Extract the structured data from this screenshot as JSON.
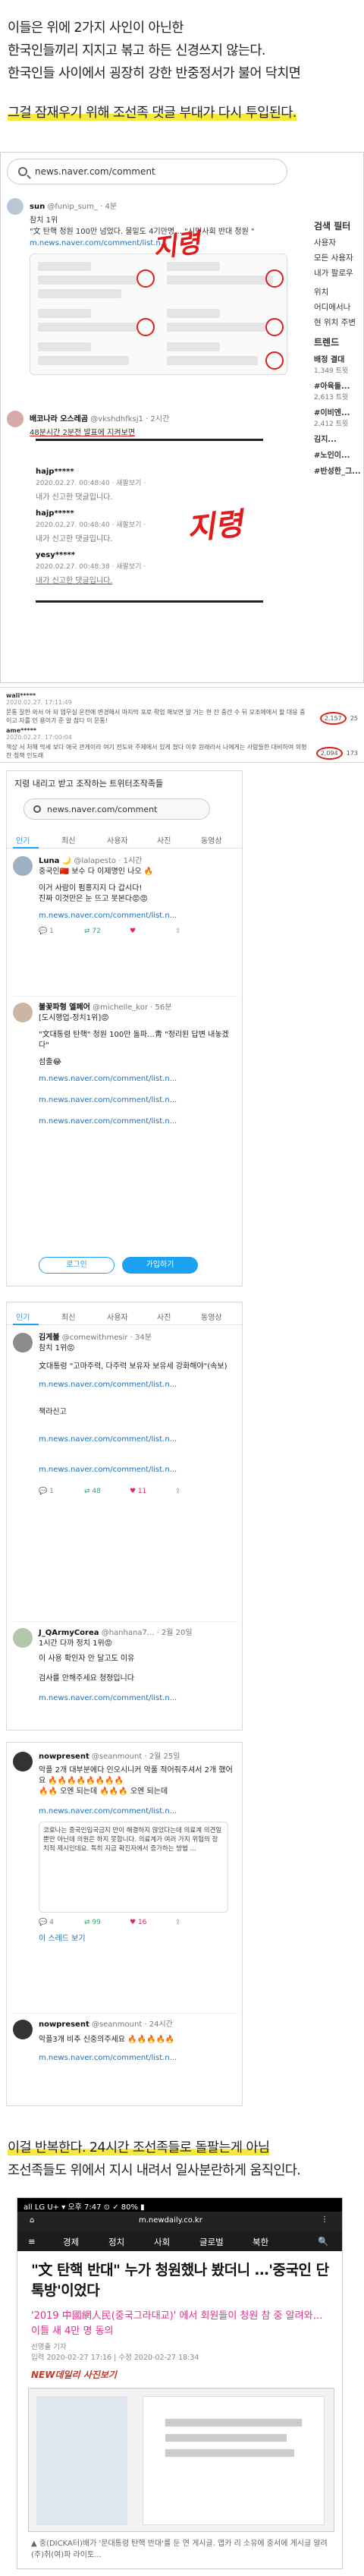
{
  "intro": {
    "lines": [
      "이들은 위에 2가지 사인이 아닌한",
      "한국인들끼리 지지고 볶고 하든 신경쓰지 않는다.",
      "한국인들 사이에서 굉장히 강한 반중정서가 불어 닥치면"
    ],
    "highlight": "그걸 잠재우기 위해 조선족 댓글 부대가 다시 투입된다."
  },
  "shotA": {
    "url": "news.naver.com/comment",
    "sidebar": {
      "title1": "검색 필터",
      "filters": [
        "사용자",
        "모든 사용자",
        "내가 팔로우"
      ],
      "loc_title": "위치",
      "loc": [
        "어디에서나",
        "현 위치 주변"
      ],
      "trend_title": "트렌드",
      "trends": [
        {
          "name": "배정 결대",
          "count": "1,349 트윗"
        },
        {
          "name": "#아육돌...",
          "count": "2,613 트윗"
        },
        {
          "name": "#이비엔...",
          "count": "2,412 트윗"
        },
        {
          "name": "김지...",
          "count": ""
        },
        {
          "name": "#노인이...",
          "count": ""
        },
        {
          "name": "#반성한_그...",
          "count": ""
        }
      ]
    },
    "tweet1": {
      "name": "sun",
      "handle": "@funip_sum_ · 4분",
      "subhead": "참치 1위",
      "body": "\"文 탄핵 청원 100만 넘었다. 물밑도 4기만명… \"시민사회 반대 청원 \"",
      "link": "m.news.naver.com/comment/list.n..."
    },
    "note1": "지령",
    "tweet2": {
      "name": "배코나라 오스레곰",
      "handle": "@vkshdhfksj1 · 2시간",
      "subhead": "48분시간 2분전 발표에 지켜보면"
    },
    "replies": [
      {
        "name": "hajp*****",
        "date": "2020.02.27. 00:48:40 · 새팔보기 ·",
        "text": "내가 신고한 댓글입니다."
      },
      {
        "name": "hajp*****",
        "date": "2020.02.27. 00:48:40 · 새팔보기 ·",
        "text": "내가 신고한 댓글입니다."
      },
      {
        "name": "yesy*****",
        "date": "2020.02.27. 00:48:38 · 새팔보기 ·",
        "text": "내가 신고한 댓글입니다."
      }
    ],
    "note2": "지령"
  },
  "comment_strip": {
    "rows": [
      {
        "user": "wali*****",
        "date": "2020.02.27. 17:11:49",
        "text": "문통 잘한 와서 아 되 업무실 운전에 변경해서 마지막 포로 확업 해보면 알 거는 현 잔 중간 수 뒤 모조에에서 할 대응 중이고 자를 인 용이가 준 알 참다 이 문통!",
        "likes": "2,157",
        "dislikes": "25"
      },
      {
        "user": "ame*****",
        "date": "2020.02.27. 17:00:04",
        "text": "책상 서 처해 막세 보다 애국 관게이라 여기 전도와 주제에서 있게 쳤다 이후 원래라서 나에게는 사람들한 대비하여 의형찬 청책 인도래",
        "likes": "2,094",
        "dislikes": "173"
      }
    ]
  },
  "shotB": {
    "title": "지령 내리고 받고 조작하는 트위터조작족들",
    "url": "news.naver.com/comment",
    "tabs": [
      "인기",
      "최신",
      "사용자",
      "사진",
      "동영상"
    ],
    "tweets": [
      {
        "name": "Luna 🌙",
        "handle": "@lalapesto · 1시간",
        "sub": "중국인🇨🇳 보수 다 이제명인 나오 🔥",
        "body": "이거 사람이 펌홍지지 다 갑시다!\n진짜 이것만은 눈 뜨고 못본다😡😡",
        "link": "m.news.naver.com/comment/list.n...",
        "reply": "1",
        "rt": "72",
        "like": ""
      },
      {
        "name": "불꽃파형 엘페어",
        "handle": "@michelle_kor · 56분",
        "sub": "[도시행업-정치1위]😡",
        "body": "\"文대통령 탄핵\" 청원 100만 돌파…靑 \"정리된 답변 내놓겠다\"",
        "extra": "섬출😂",
        "links": [
          "m.news.naver.com/comment/list.n...",
          "m.news.naver.com/comment/list.n...",
          "m.news.naver.com/comment/list.n..."
        ]
      }
    ],
    "login": "로그인",
    "join": "가입하기"
  },
  "shotC": {
    "tabs": [
      "인기",
      "최신",
      "사용자",
      "사진",
      "동영상"
    ],
    "t1": {
      "name": "김게불",
      "handle": "@comewithmesir · 34분",
      "sub": "참치 1위😡",
      "body": "文대통령 \"고마주력, 다주력 보유자 보유세 강화해야\"(속보)",
      "link": "m.news.naver.com/comment/list.n...",
      "extra": "책라신고",
      "links2": [
        "m.news.naver.com/comment/list.n...",
        "m.news.naver.com/comment/list.n..."
      ],
      "reply": "1",
      "rt": "48",
      "like": "11"
    },
    "t2": {
      "name": "J_QArmyCorea",
      "handle": "@hanhana7... · 2월 20일",
      "sub": "1시간 다까 정치 1위😡",
      "body": "이 사용 확인자 안 달고도 이유",
      "extra": "검사를 안해주세요 청정입니다",
      "link": "m.news.naver.com/comment/list.n..."
    }
  },
  "shotD": {
    "t1": {
      "name": "nowpresent",
      "handle": "@seanmount · 2월 25일",
      "body": "악플 2개 대부분에다 인오시니커 악풀 적어줘주셔서 2개 했어요 🔥🔥🔥🔥🔥🔥🔥🔥\n🔥🔥 오엔 되는데 🔥🔥🔥 오엔 되는데",
      "link": "m.news.naver.com/comment/list.n...",
      "quote": "코로나는 중국인입국금지 만이 해결하지 않았다는데 의료계 의견일 뿐만 아닌데 의원은 하지 못합니다. 의료계가 여러 가지 위험의 정치적 제시인데요. 특히 지금 확진자에서 증가하는 방법 ...",
      "reply": "4",
      "rt": "99",
      "like": "16"
    },
    "t2": {
      "name": "nowpresent",
      "handle": "@seanmount · 24시간",
      "body": "악플3개 비추 신중의주세요 🔥🔥🔥🔥🔥",
      "link": "m.news.naver.com/comment/list.n..."
    },
    "more": "이 스레드 보기"
  },
  "outro": {
    "line1": "이걸 반복한다. 24시간 조선족들로 돌팔는게 아님",
    "line2": "조선족들도 위에서 지시 내려서 일사분란하게 움직인다."
  },
  "phone": {
    "status": "all LG U+ ▾  오후 7:47  ⊙ ✓ 80% ▮",
    "url": "m.newdaily.co.kr",
    "nav": [
      "≡",
      "경제",
      "정치",
      "사회",
      "글로벌",
      "북한",
      "🔍"
    ],
    "title": "\"文 탄핵 반대\" 누가 청원했나 봤더니 …'중국인 단톡방'이었다",
    "subtitle": "'2019 中國網人民(중국그라대교)' 에서 회원들이 청원 참 중 알려와… 이틀 새 4만 명 동의",
    "meta1": "선명출 기자",
    "meta2": "입력 2020-02-27 17:16 | 수정 2020-02-27 18:34",
    "brand": "NEW데일리 사진보기",
    "caption": "▲ 중(DICKA터)배가 '문대통령 탄핵 반대'를 둔 연 게시글. 앱카 리 소유에 중서에 게시글 알려 (주)취(여)파 라이토..."
  }
}
